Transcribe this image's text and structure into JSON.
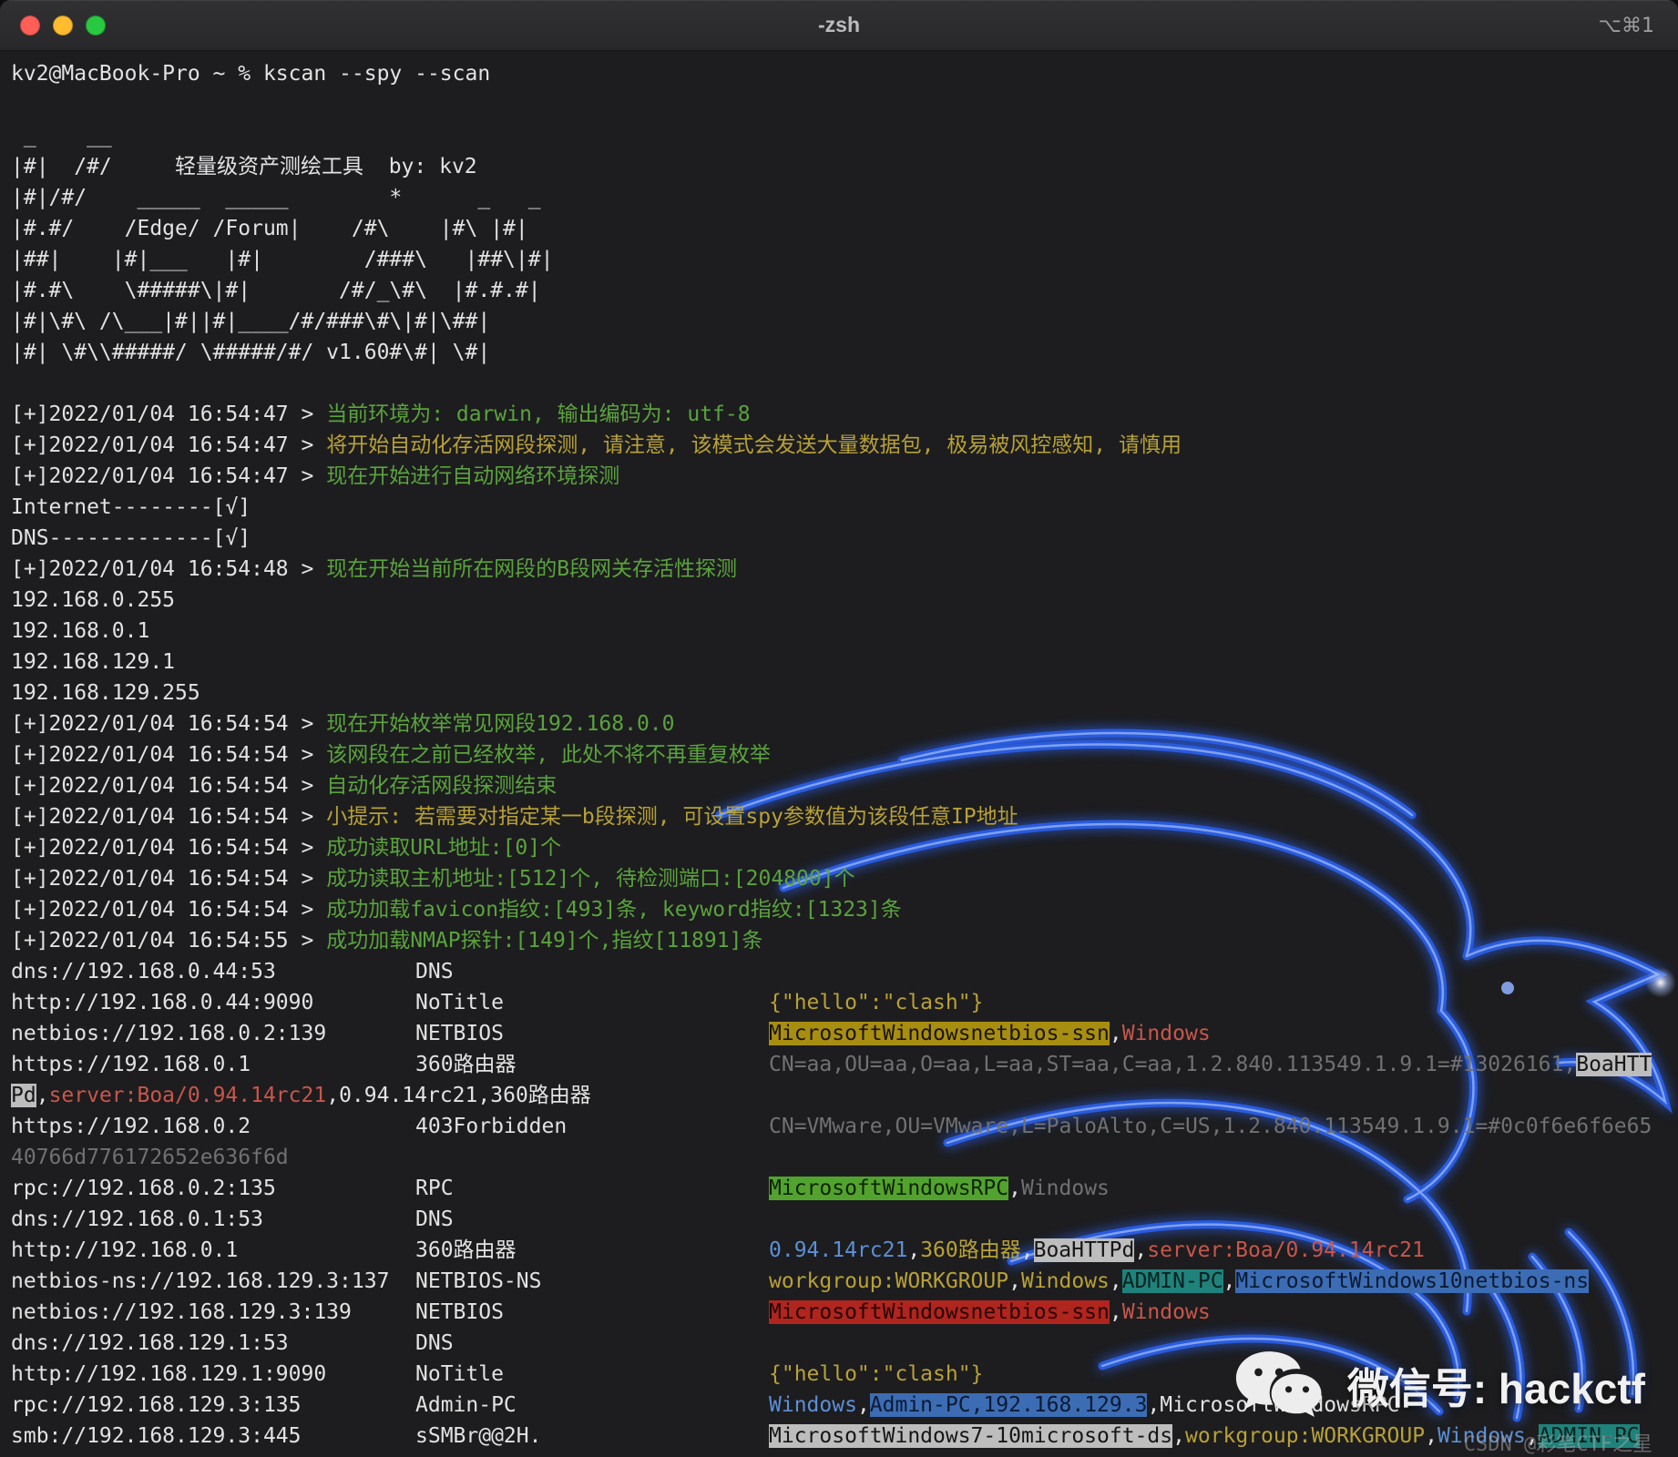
{
  "window": {
    "title": "-zsh",
    "shortcut": "⌥⌘1"
  },
  "colors": {
    "ansi_green": "#5aa33c",
    "ansi_yellow": "#b8a136",
    "ansi_red": "#c8564b",
    "ansi_blue": "#5c8fd6",
    "ansi_gray": "#707172",
    "highlight_gold": "#a88e10",
    "highlight_gray": "#bdbdbd",
    "highlight_green": "#52a32e",
    "highlight_teal": "#1f827b",
    "highlight_blue": "#3c6cb4",
    "highlight_red": "#b0251e",
    "dragon_blue": "#2a5fe8",
    "traffic_red": "#ff5f57",
    "traffic_yellow": "#febc2e",
    "traffic_green": "#28c840"
  },
  "watermark": {
    "wechat_label": "微信号: hackctf",
    "csdn_label": "CSDN @彩笔CTF之星"
  },
  "terminal": {
    "lines": [
      {
        "type": "text",
        "segments": [
          {
            "t": "kv2@MacBook-Pro ~ % kscan --spy --scan",
            "s": "d"
          }
        ]
      },
      {
        "type": "blank"
      },
      {
        "type": "text",
        "segments": [
          {
            "t": " _    __",
            "s": "d"
          }
        ]
      },
      {
        "type": "text",
        "segments": [
          {
            "t": "|#|  /#/     轻量级资产测绘工具  by: kv2",
            "s": "d"
          }
        ]
      },
      {
        "type": "text",
        "segments": [
          {
            "t": "|#|/#/    _____  _____        *      _   _",
            "s": "d"
          }
        ]
      },
      {
        "type": "text",
        "segments": [
          {
            "t": "|#.#/    /Edge/ /Forum|    /#\\    |#\\ |#|",
            "s": "d"
          }
        ]
      },
      {
        "type": "text",
        "segments": [
          {
            "t": "|##|    |#|___   |#|        /###\\   |##\\|#|",
            "s": "d"
          }
        ]
      },
      {
        "type": "text",
        "segments": [
          {
            "t": "|#.#\\    \\#####\\|#|       /#/_\\#\\  |#.#.#|",
            "s": "d"
          }
        ]
      },
      {
        "type": "text",
        "segments": [
          {
            "t": "|#|\\#\\ /\\___|#||#|____/#/###\\#\\|#|\\##|",
            "s": "d"
          }
        ]
      },
      {
        "type": "text",
        "segments": [
          {
            "t": "|#| \\#\\\\#####/ \\#####/#/ v1.60#\\#| \\#|",
            "s": "d"
          }
        ]
      },
      {
        "type": "blank"
      },
      {
        "type": "text",
        "segments": [
          {
            "t": "[+]2022/01/04 16:54:47 > ",
            "s": "d"
          },
          {
            "t": "当前环境为: darwin, 输出编码为: utf-8",
            "s": "g"
          }
        ]
      },
      {
        "type": "text",
        "segments": [
          {
            "t": "[+]2022/01/04 16:54:47 > ",
            "s": "d"
          },
          {
            "t": "将开始自动化存活网段探测, 请注意, 该模式会发送大量数据包, 极易被风控感知, 请慎用",
            "s": "y"
          }
        ]
      },
      {
        "type": "text",
        "segments": [
          {
            "t": "[+]2022/01/04 16:54:47 > ",
            "s": "d"
          },
          {
            "t": "现在开始进行自动网络环境探测",
            "s": "g"
          }
        ]
      },
      {
        "type": "text",
        "segments": [
          {
            "t": "Internet--------[√]",
            "s": "d"
          }
        ]
      },
      {
        "type": "text",
        "segments": [
          {
            "t": "DNS-------------[√]",
            "s": "d"
          }
        ]
      },
      {
        "type": "text",
        "segments": [
          {
            "t": "[+]2022/01/04 16:54:48 > ",
            "s": "d"
          },
          {
            "t": "现在开始当前所在网段的B段网关存活性探测",
            "s": "g"
          }
        ]
      },
      {
        "type": "text",
        "segments": [
          {
            "t": "192.168.0.255",
            "s": "d"
          }
        ]
      },
      {
        "type": "text",
        "segments": [
          {
            "t": "192.168.0.1",
            "s": "d"
          }
        ]
      },
      {
        "type": "text",
        "segments": [
          {
            "t": "192.168.129.1",
            "s": "d"
          }
        ]
      },
      {
        "type": "text",
        "segments": [
          {
            "t": "192.168.129.255",
            "s": "d"
          }
        ]
      },
      {
        "type": "text",
        "segments": [
          {
            "t": "[+]2022/01/04 16:54:54 > ",
            "s": "d"
          },
          {
            "t": "现在开始枚举常见网段192.168.0.0",
            "s": "g"
          }
        ]
      },
      {
        "type": "text",
        "segments": [
          {
            "t": "[+]2022/01/04 16:54:54 > ",
            "s": "d"
          },
          {
            "t": "该网段在之前已经枚举, 此处不将不再重复枚举",
            "s": "g"
          }
        ]
      },
      {
        "type": "text",
        "segments": [
          {
            "t": "[+]2022/01/04 16:54:54 > ",
            "s": "d"
          },
          {
            "t": "自动化存活网段探测结束",
            "s": "g"
          }
        ]
      },
      {
        "type": "text",
        "segments": [
          {
            "t": "[+]2022/01/04 16:54:54 > ",
            "s": "d"
          },
          {
            "t": "小提示: 若需要对指定某一b段探测, 可设置spy参数值为该段任意IP地址",
            "s": "y"
          }
        ]
      },
      {
        "type": "text",
        "segments": [
          {
            "t": "[+]2022/01/04 16:54:54 > ",
            "s": "d"
          },
          {
            "t": "成功读取URL地址:[0]个",
            "s": "g"
          }
        ]
      },
      {
        "type": "text",
        "segments": [
          {
            "t": "[+]2022/01/04 16:54:54 > ",
            "s": "d"
          },
          {
            "t": "成功读取主机地址:[512]个, 待检测端口:[204800]个",
            "s": "g"
          }
        ]
      },
      {
        "type": "text",
        "segments": [
          {
            "t": "[+]2022/01/04 16:54:54 > ",
            "s": "d"
          },
          {
            "t": "成功加载favicon指纹:[493]条, keyword指纹:[1323]条",
            "s": "g"
          }
        ]
      },
      {
        "type": "text",
        "segments": [
          {
            "t": "[+]2022/01/04 16:54:55 > ",
            "s": "d"
          },
          {
            "t": "成功加载NMAP探针:[149]个,指纹[11891]条",
            "s": "g"
          }
        ]
      },
      {
        "type": "row",
        "col1": "dns://192.168.0.44:53",
        "col2": "DNS",
        "segments": []
      },
      {
        "type": "row",
        "col1": "http://192.168.0.44:9090",
        "col2": "NoTitle",
        "segments": [
          {
            "t": "{\"hello\":\"clash\"}",
            "s": "y"
          }
        ]
      },
      {
        "type": "row",
        "col1": "netbios://192.168.0.2:139",
        "col2": "NETBIOS",
        "segments": [
          {
            "t": "MicrosoftWindowsnetbios-ssn",
            "s": "hgold"
          },
          {
            "t": ",",
            "s": "d"
          },
          {
            "t": "Windows",
            "s": "r"
          }
        ]
      },
      {
        "type": "row",
        "col1": "https://192.168.0.1",
        "col2": "360路由器",
        "segments": [
          {
            "t": "CN=aa,OU=aa,O=aa,L=aa,ST=aa,C=aa,1.2.840.113549.1.9.1=#13026161,",
            "s": "gy"
          },
          {
            "t": "BoaHTT",
            "s": "hgray"
          }
        ]
      },
      {
        "type": "text",
        "segments": [
          {
            "t": "Pd",
            "s": "hgray"
          },
          {
            "t": ",",
            "s": "d"
          },
          {
            "t": "server:Boa/0.94.14rc21",
            "s": "r"
          },
          {
            "t": ",",
            "s": "d"
          },
          {
            "t": "0.94.14rc21",
            "s": "d"
          },
          {
            "t": ",",
            "s": "d"
          },
          {
            "t": "360路由器",
            "s": "d"
          }
        ]
      },
      {
        "type": "row",
        "col1": "https://192.168.0.2",
        "col2": "403Forbidden",
        "segments": [
          {
            "t": "CN=VMware,OU=VMware,L=PaloAlto,C=US,1.2.840.113549.1.9.1=#0c0f6e6f6e65",
            "s": "gy"
          }
        ]
      },
      {
        "type": "text",
        "segments": [
          {
            "t": "40766d776172652e636f6d",
            "s": "gy"
          }
        ]
      },
      {
        "type": "row",
        "col1": "rpc://192.168.0.2:135",
        "col2": "RPC",
        "segments": [
          {
            "t": "MicrosoftWindowsRPC",
            "s": "hgreen"
          },
          {
            "t": ",",
            "s": "d"
          },
          {
            "t": "Windows",
            "s": "gy"
          }
        ]
      },
      {
        "type": "row",
        "col1": "dns://192.168.0.1:53",
        "col2": "DNS",
        "segments": []
      },
      {
        "type": "row",
        "col1": "http://192.168.0.1",
        "col2": "360路由器",
        "segments": [
          {
            "t": "0.94.14rc21",
            "s": "b"
          },
          {
            "t": ",",
            "s": "d"
          },
          {
            "t": "360路由器",
            "s": "y"
          },
          {
            "t": ",",
            "s": "d"
          },
          {
            "t": "BoaHTTPd",
            "s": "hgray"
          },
          {
            "t": ",",
            "s": "d"
          },
          {
            "t": "server:Boa/0.94.14rc21",
            "s": "r"
          }
        ]
      },
      {
        "type": "row",
        "col1": "netbios-ns://192.168.129.3:137",
        "col2": "NETBIOS-NS",
        "segments": [
          {
            "t": "workgroup:WORKGROUP",
            "s": "y"
          },
          {
            "t": ",",
            "s": "d"
          },
          {
            "t": "Windows",
            "s": "y"
          },
          {
            "t": ",",
            "s": "d"
          },
          {
            "t": "ADMIN-PC",
            "s": "hteal"
          },
          {
            "t": ",",
            "s": "d"
          },
          {
            "t": "MicrosoftWindows10netbios-ns",
            "s": "hblue"
          }
        ]
      },
      {
        "type": "row",
        "col1": "netbios://192.168.129.3:139",
        "col2": "NETBIOS",
        "segments": [
          {
            "t": "MicrosoftWindowsnetbios-ssn",
            "s": "hred"
          },
          {
            "t": ",",
            "s": "d"
          },
          {
            "t": "Windows",
            "s": "r"
          }
        ]
      },
      {
        "type": "row",
        "col1": "dns://192.168.129.1:53",
        "col2": "DNS",
        "segments": []
      },
      {
        "type": "row",
        "col1": "http://192.168.129.1:9090",
        "col2": "NoTitle",
        "segments": [
          {
            "t": "{\"hello\":\"clash\"}",
            "s": "y"
          }
        ]
      },
      {
        "type": "row",
        "col1": "rpc://192.168.129.3:135",
        "col2": "Admin-PC",
        "segments": [
          {
            "t": "Windows",
            "s": "b"
          },
          {
            "t": ",",
            "s": "d"
          },
          {
            "t": "Admin-PC,192.168.129.3",
            "s": "hblue"
          },
          {
            "t": ",",
            "s": "d"
          },
          {
            "t": "MicrosoftWindowsRPC",
            "s": "d"
          }
        ]
      },
      {
        "type": "row",
        "col1": "smb://192.168.129.3:445",
        "col2": "sSMBr@@2H.",
        "segments": [
          {
            "t": "MicrosoftWindows7-10microsoft-ds",
            "s": "hgray"
          },
          {
            "t": ",",
            "s": "d"
          },
          {
            "t": "workgroup:WORKGROUP",
            "s": "y"
          },
          {
            "t": ",",
            "s": "d"
          },
          {
            "t": "Windows",
            "s": "b"
          },
          {
            "t": ",",
            "s": "d"
          },
          {
            "t": "ADMIN-PC",
            "s": "hteal"
          }
        ]
      }
    ]
  }
}
